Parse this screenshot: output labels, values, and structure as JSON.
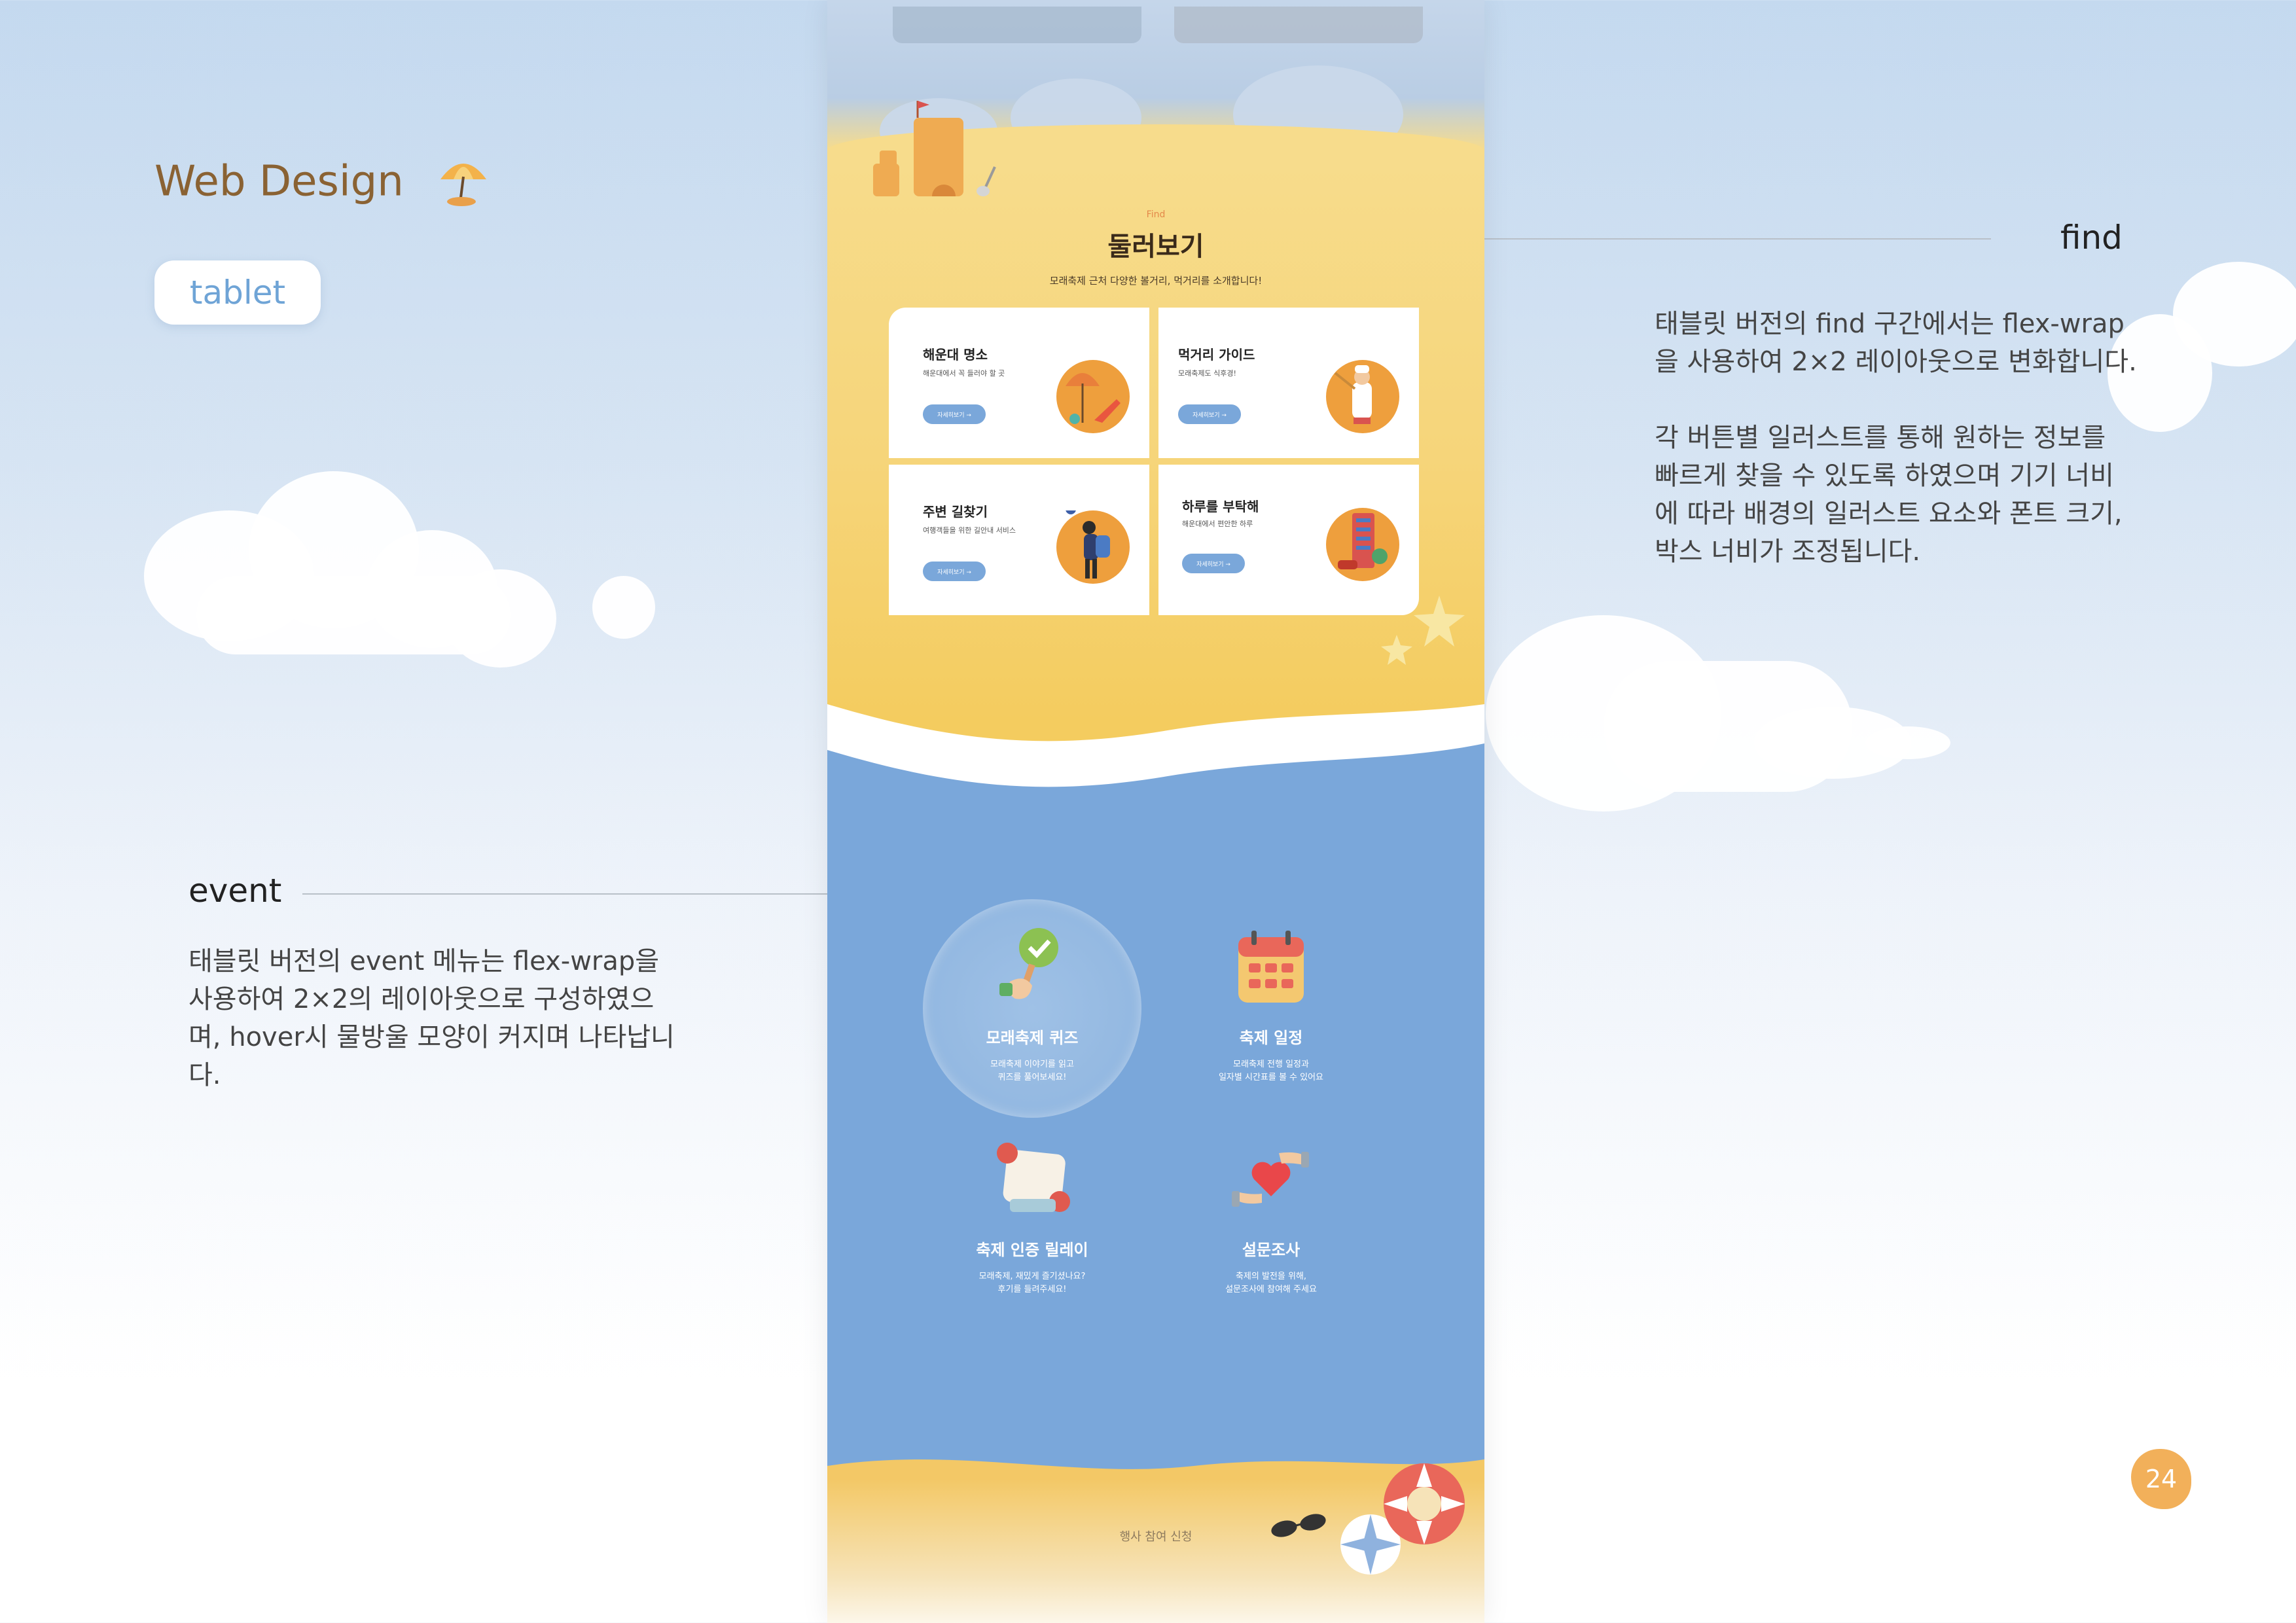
{
  "header": {
    "title": "Web Design",
    "umbrella_icon": "beach-umbrella-icon",
    "tab": "tablet"
  },
  "annotations": {
    "find": {
      "title": "find",
      "p1_l1": "태블릿 버전의 find 구간에서는 flex-wrap",
      "p1_l2": "을 사용하여 2×2 레이아웃으로 변화합니다.",
      "p2_l1": "각 버튼별 일러스트를 통해 원하는 정보를",
      "p2_l2": "빠르게 찾을 수 있도록 하였으며 기기 너비",
      "p2_l3": "에 따라 배경의 일러스트 요소와 폰트 크기,",
      "p2_l4": "박스 너비가 조정됩니다."
    },
    "event": {
      "title": "event",
      "l1": "태블릿 버전의 event 메뉴는 flex-wrap을",
      "l2": "사용하여 2×2의 레이아웃으로 구성하였으",
      "l3": "며, hover시 물방울 모양이 커지며 나타납니",
      "l4": "다."
    }
  },
  "page_number": "24",
  "colors": {
    "sand": "#f6d57a",
    "sea": "#7aa7da",
    "accent": "#f2aa4c",
    "title": "#8a6233"
  },
  "find_section": {
    "label": "Find",
    "heading": "둘러보기",
    "subtitle": "모래축제 근처 다양한 볼거리, 먹거리를 소개합니다!",
    "cards": [
      {
        "title": "해운대 명소",
        "desc": "해운대에서 꼭 들러야 할 곳",
        "button": "자세히보기 →",
        "icon": "beach-chair-icon"
      },
      {
        "title": "먹거리 가이드",
        "desc": "모래축제도 식후경!",
        "button": "자세히보기 →",
        "icon": "chef-icon"
      },
      {
        "title": "주변 길찾기",
        "desc": "여행객들을 위한 길안내 서비스",
        "button": "자세히보기 →",
        "icon": "traveler-icon"
      },
      {
        "title": "하루를 부탁해",
        "desc": "해운대에서 편안한 하루",
        "button": "자세히보기 →",
        "icon": "hotel-icon"
      }
    ]
  },
  "event_section": {
    "items": [
      {
        "title": "모래축제 퀴즈",
        "desc1": "모래축제 이야기를 읽고",
        "desc2": "퀴즈를 풀어보세요!",
        "icon": "quiz-check-icon"
      },
      {
        "title": "축제 일정",
        "desc1": "모래축제 전행 일정과",
        "desc2": "일자별 시간표를 볼 수 있어요",
        "icon": "calendar-icon"
      },
      {
        "title": "축제 인증 릴레이",
        "desc1": "모래축제, 재밌게 즐기셨나요?",
        "desc2": "후기를 들려주세요!",
        "icon": "quote-bubble-icon"
      },
      {
        "title": "설문조사",
        "desc1": "축제의 발전을 위해,",
        "desc2": "설문조사에 참여해 주세요",
        "icon": "heart-hands-icon"
      }
    ]
  },
  "footer": {
    "text": "행사 참여 신청"
  }
}
